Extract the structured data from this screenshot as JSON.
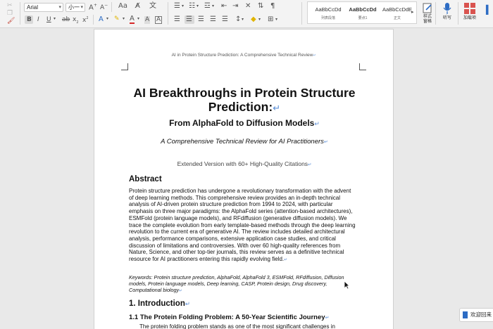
{
  "ribbon": {
    "font_name": "Arial",
    "font_size": "小一",
    "styles": [
      {
        "preview": "AaBbCcDd",
        "name": "列表段落"
      },
      {
        "preview": "AaBbCcDd",
        "name": "要点1"
      },
      {
        "preview": "AaBbCcDdE",
        "name": "正文"
      }
    ],
    "style_pane_label": "样式\n窗格",
    "dictate_label": "听写",
    "addins_label": "加载项"
  },
  "document": {
    "header": "AI in Protein Structure Prediction: A Comprehensive Technical Review",
    "title": "AI Breakthroughs in Protein Structure Prediction:",
    "subtitle": "From AlphaFold to Diffusion Models",
    "italic_subtitle": "A Comprehensive Technical Review for AI Practitioners",
    "extended": "Extended Version with 60+ High-Quality Citations",
    "abstract_heading": "Abstract",
    "abstract_text": "Protein structure prediction has undergone a revolutionary transformation with the advent of deep learning methods. This comprehensive review provides an in-depth technical analysis of AI-driven protein structure prediction from 1994 to 2024, with particular emphasis on three major paradigms: the AlphaFold series (attention-based architectures), ESMFold (protein language models), and RFdiffusion (generative diffusion models). We trace the complete evolution from early template-based methods through the deep learning revolution to the current era of generative AI. The review includes detailed architectural analysis, performance comparisons, extensive application case studies, and critical discussion of limitations and controversies. With over 60 high-quality references from Nature, Science, and other top-tier journals, this review serves as a definitive technical resource for AI practitioners entering this rapidly evolving field.",
    "keywords": "Keywords: Protein structure prediction, AlphaFold, AlphaFold 3, ESMFold, RFdiffusion, Diffusion models, Protein language models, Deep learning, CASP, Protein design, Drug discovery, Computational biology",
    "section1": "1. Introduction",
    "section1_1": "1.1 The Protein Folding Problem: A 50-Year Scientific Journey",
    "para_start": "The protein folding problem stands as one of the most significant challenges in"
  },
  "welcome_label": "欢迎回来"
}
